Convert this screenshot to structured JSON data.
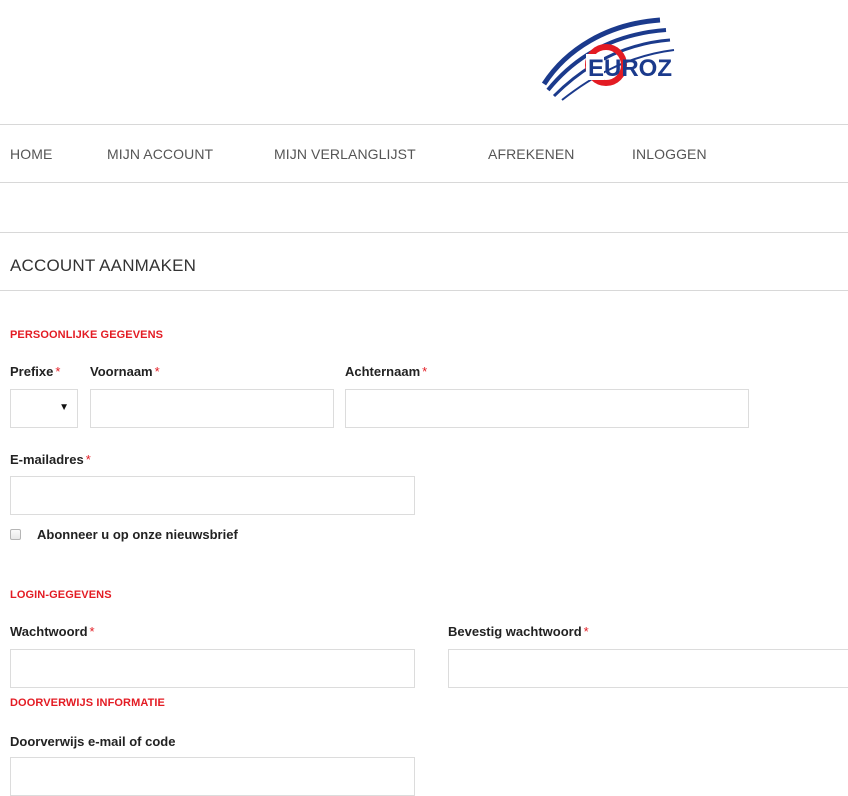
{
  "logo": {
    "text": "EUROZ"
  },
  "nav": {
    "items": [
      {
        "label": "HOME"
      },
      {
        "label": "MIJN ACCOUNT"
      },
      {
        "label": "MIJN VERLANGLIJST"
      },
      {
        "label": "AFREKENEN"
      },
      {
        "label": "INLOGGEN"
      }
    ]
  },
  "page": {
    "title": "ACCOUNT AANMAKEN"
  },
  "personal": {
    "section_title": "PERSOONLIJKE GEGEVENS",
    "prefix": {
      "label": "Prefixe",
      "required": "*",
      "value": ""
    },
    "firstname": {
      "label": "Voornaam",
      "required": "*",
      "value": ""
    },
    "lastname": {
      "label": "Achternaam",
      "required": "*",
      "value": ""
    },
    "email": {
      "label": "E-mailadres",
      "required": "*",
      "value": ""
    },
    "newsletter": {
      "label": "Abonneer u op onze nieuwsbrief",
      "checked": false
    }
  },
  "login": {
    "section_title": "LOGIN-GEGEVENS",
    "password": {
      "label": "Wachtwoord",
      "required": "*",
      "value": ""
    },
    "confirm": {
      "label": "Bevestig wachtwoord",
      "required": "*",
      "value": ""
    }
  },
  "referral": {
    "section_title": "DOORVERWIJS INFORMATIE",
    "code": {
      "label": "Doorverwijs e-mail of code",
      "value": ""
    }
  },
  "colors": {
    "accent_red": "#e31b23",
    "logo_blue": "#1b3a8c",
    "divider": "#d8d8d8"
  },
  "icons": {
    "select_arrow": "dropdown-arrow-icon"
  }
}
